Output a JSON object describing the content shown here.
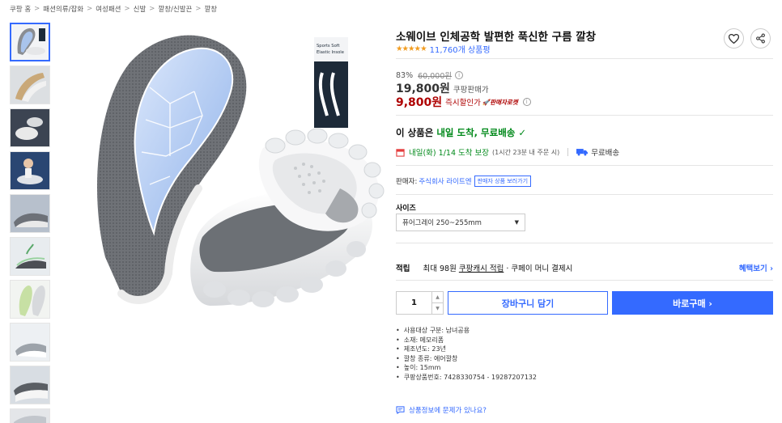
{
  "breadcrumb": [
    "쿠팡 홈",
    "패션의류/잡화",
    "여성패션",
    "신발",
    "깔창/신발끈",
    "깔창"
  ],
  "breadcrumb_sep": ">",
  "product": {
    "title": "소웨이브 인체공학 발편한 푹신한 구름 깔창",
    "stars": "★★★★★",
    "review_count": "11,760개 상품평",
    "rating_value": 4.5
  },
  "price": {
    "discount_rate": "83%",
    "original_price": "60,000원",
    "coupang_price": "19,800원",
    "coupang_label": "쿠팡판매가",
    "instant_price": "9,800원",
    "instant_label": "즉시할인가",
    "badge": "판매자로켓"
  },
  "delivery": {
    "headline_prefix": "이 상품은",
    "headline_green": "내일 도착, 무료배송",
    "arrival": "내일(화) 1/14 도착 보장",
    "arrival_note": "(1시간 23분 내 주문 시)",
    "free_shipping": "무료배송"
  },
  "seller": {
    "label": "판매자:",
    "name": "주식회사 라이트엔",
    "link": "판매자 상품 보러가기"
  },
  "options": {
    "size_label": "사이즈",
    "size_selected": "퓨어그레이 250~255mm"
  },
  "cash": {
    "title": "적립",
    "prefix": "최대 98원",
    "link": "쿠팡캐시 적립",
    "suffix": "· 쿠페이 머니 결제시",
    "more": "혜택보기 ›"
  },
  "purchase": {
    "quantity": "1",
    "cart_label": "장바구니 담기",
    "buy_label": "바로구매 ›"
  },
  "image_text": {
    "box_line1": "Sports Soft",
    "box_line2": "Elastic Insole"
  },
  "specs": [
    "사용대상 구분: 남녀공용",
    "소재: 메모리폼",
    "제조년도: 23년",
    "깔창 종류: 에어깔창",
    "높이: 15mm",
    "쿠팡상품번호: 7428330754 - 19287207132"
  ],
  "report_text": "상품정보에 문제가 있나요?",
  "colors": {
    "accent": "#346aff",
    "sale": "#ae0000",
    "delivery": "#00891a",
    "star": "#f29c1f"
  }
}
